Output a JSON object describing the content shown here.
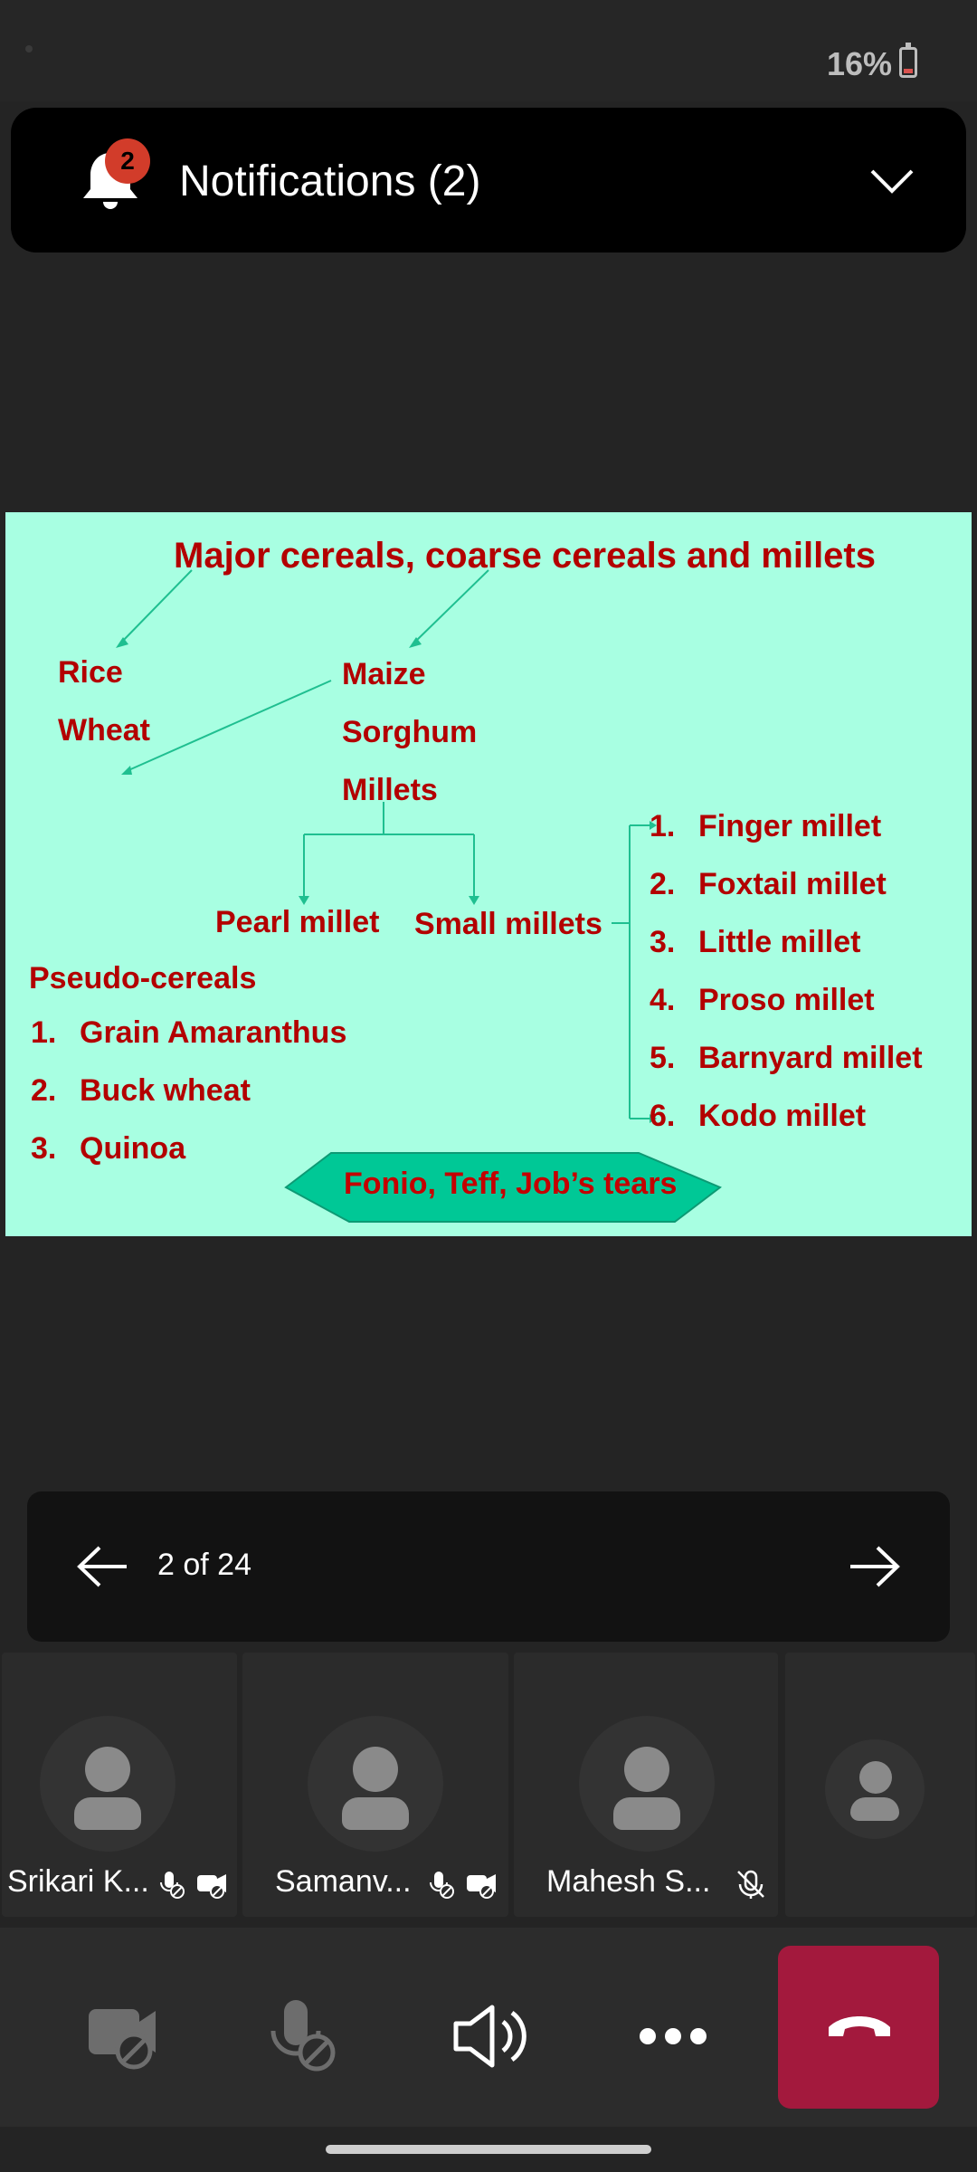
{
  "status_bar": {
    "battery": "16%"
  },
  "notifications": {
    "title": "Notifications (2)",
    "badge": "2"
  },
  "slide": {
    "title": "Major cereals, coarse cereals and millets",
    "major": [
      "Rice",
      "Wheat"
    ],
    "coarse": [
      "Maize",
      "Sorghum",
      "Millets"
    ],
    "millet_groups": [
      "Pearl millet",
      "Small millets"
    ],
    "small_millets": [
      {
        "num": "1.",
        "name": "Finger millet"
      },
      {
        "num": "2.",
        "name": "Foxtail millet"
      },
      {
        "num": "3.",
        "name": "Little millet"
      },
      {
        "num": "4.",
        "name": "Proso millet"
      },
      {
        "num": "5.",
        "name": "Barnyard millet"
      },
      {
        "num": "6.",
        "name": "Kodo millet"
      }
    ],
    "pseudo_title": "Pseudo-cereals",
    "pseudo": [
      {
        "num": "1.",
        "name": "Grain Amaranthus"
      },
      {
        "num": "2.",
        "name": "Buck wheat"
      },
      {
        "num": "3.",
        "name": "Quinoa"
      }
    ],
    "other": "Fonio, Teff, Job’s tears"
  },
  "pager": {
    "label": "2 of 24"
  },
  "participants": [
    {
      "name": "Srikari K...",
      "icons": [
        "mic-off-icon",
        "video-off-icon"
      ]
    },
    {
      "name": "Samanv...",
      "icons": [
        "mic-off-icon",
        "video-off-icon"
      ]
    },
    {
      "name": "Mahesh S...",
      "icons": [
        "muted-icon"
      ]
    },
    {
      "name": "",
      "icons": []
    }
  ],
  "controls": [
    "camera-off-icon",
    "mic-off-icon",
    "speaker-icon",
    "more-icon",
    "hangup-icon"
  ],
  "colors": {
    "accent_red": "#b30000",
    "slide_bg": "#a8ffe2",
    "hangup": "#a3193d",
    "badge": "#d23c2a"
  }
}
